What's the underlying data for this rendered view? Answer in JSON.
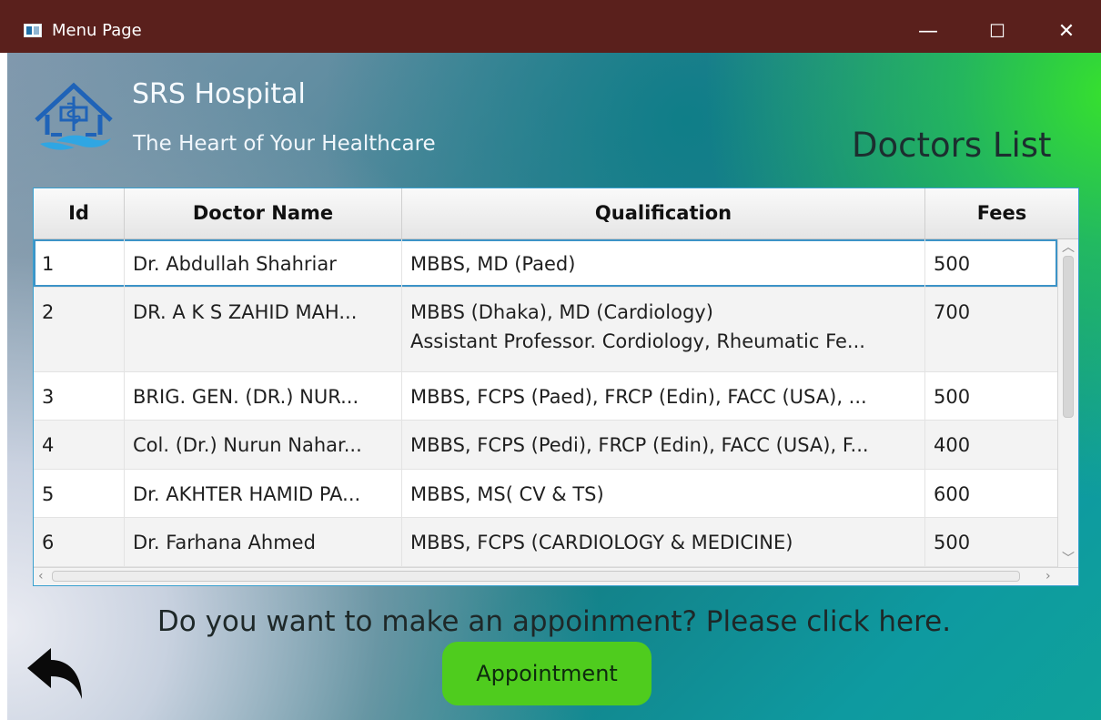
{
  "window": {
    "title": "Menu Page",
    "controls": {
      "minimize": "—",
      "maximize": "☐",
      "close": "✕"
    }
  },
  "header": {
    "logo_icon": "hospital-house-icon",
    "hospital_name": "SRS Hospital",
    "tagline": "The Heart of Your Healthcare",
    "page_heading": "Doctors List"
  },
  "table": {
    "columns": [
      "Id",
      "Doctor Name",
      "Qualification",
      "Fees"
    ],
    "rows": [
      {
        "id": "1",
        "name": "Dr. Abdullah Shahriar",
        "qualification": "MBBS, MD (Paed)",
        "qualification2": "",
        "fees": "500"
      },
      {
        "id": "2",
        "name": "DR. A K S ZAHID MAH...",
        "qualification": "MBBS (Dhaka), MD (Cardiology)",
        "qualification2": "Assistant Professor. Cordiology, Rheumatic Fe...",
        "fees": "700"
      },
      {
        "id": "3",
        "name": "BRIG. GEN. (DR.) NUR...",
        "qualification": "MBBS, FCPS (Paed), FRCP (Edin), FACC (USA), ...",
        "qualification2": "",
        "fees": "500"
      },
      {
        "id": "4",
        "name": "Col. (Dr.) Nurun Nahar...",
        "qualification": "MBBS, FCPS (Pedi), FRCP (Edin), FACC (USA), F...",
        "qualification2": "",
        "fees": "400"
      },
      {
        "id": "5",
        "name": "Dr. AKHTER HAMID PA...",
        "qualification": "MBBS, MS( CV & TS)",
        "qualification2": "",
        "fees": "600"
      },
      {
        "id": "6",
        "name": "Dr. Farhana Ahmed",
        "qualification": "MBBS, FCPS (CARDIOLOGY & MEDICINE)",
        "qualification2": "",
        "fees": "500"
      }
    ],
    "selected_row_id": "1"
  },
  "footer": {
    "prompt": "Do you want to make an appoinment? Please click here.",
    "appointment_button": "Appointment",
    "back_icon": "back-arrow-icon"
  },
  "colors": {
    "titlebar": "#5a201c",
    "button": "#4fcc1e",
    "selection_border": "#3c93c7"
  }
}
